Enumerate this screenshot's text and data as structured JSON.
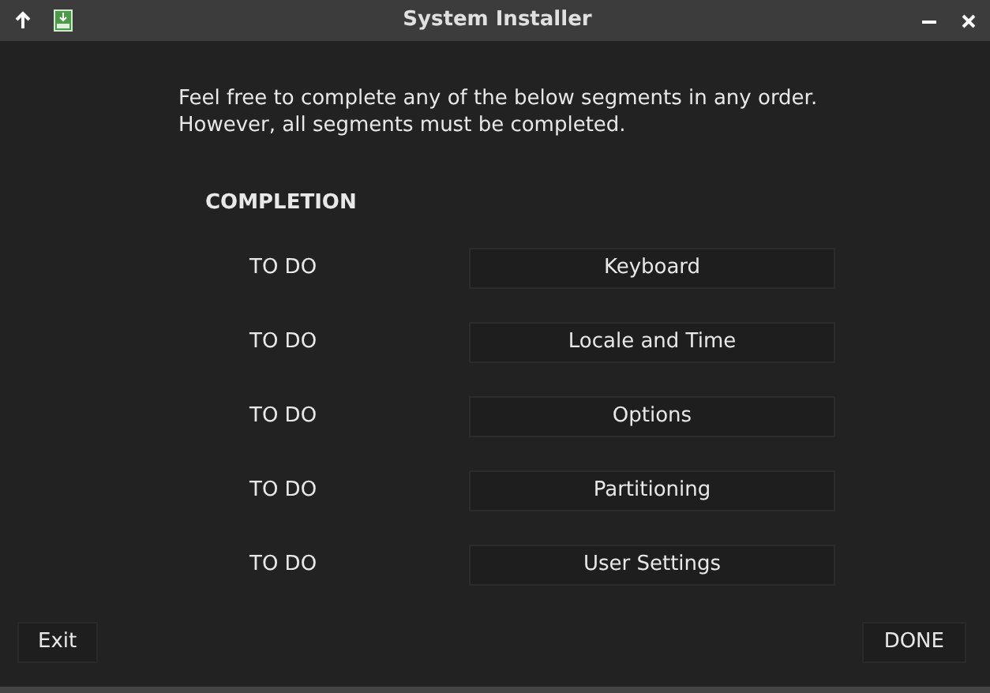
{
  "window": {
    "title": "System Installer"
  },
  "intro": [
    "Feel free to complete any of the below segments in any order.",
    "However, all segments must be completed."
  ],
  "heading": "COMPLETION",
  "segments": [
    {
      "status": "TO DO",
      "label": "Keyboard"
    },
    {
      "status": "TO DO",
      "label": "Locale and Time"
    },
    {
      "status": "TO DO",
      "label": "Options"
    },
    {
      "status": "TO DO",
      "label": "Partitioning"
    },
    {
      "status": "TO DO",
      "label": "User Settings"
    }
  ],
  "buttons": {
    "exit": "Exit",
    "done": "DONE"
  }
}
